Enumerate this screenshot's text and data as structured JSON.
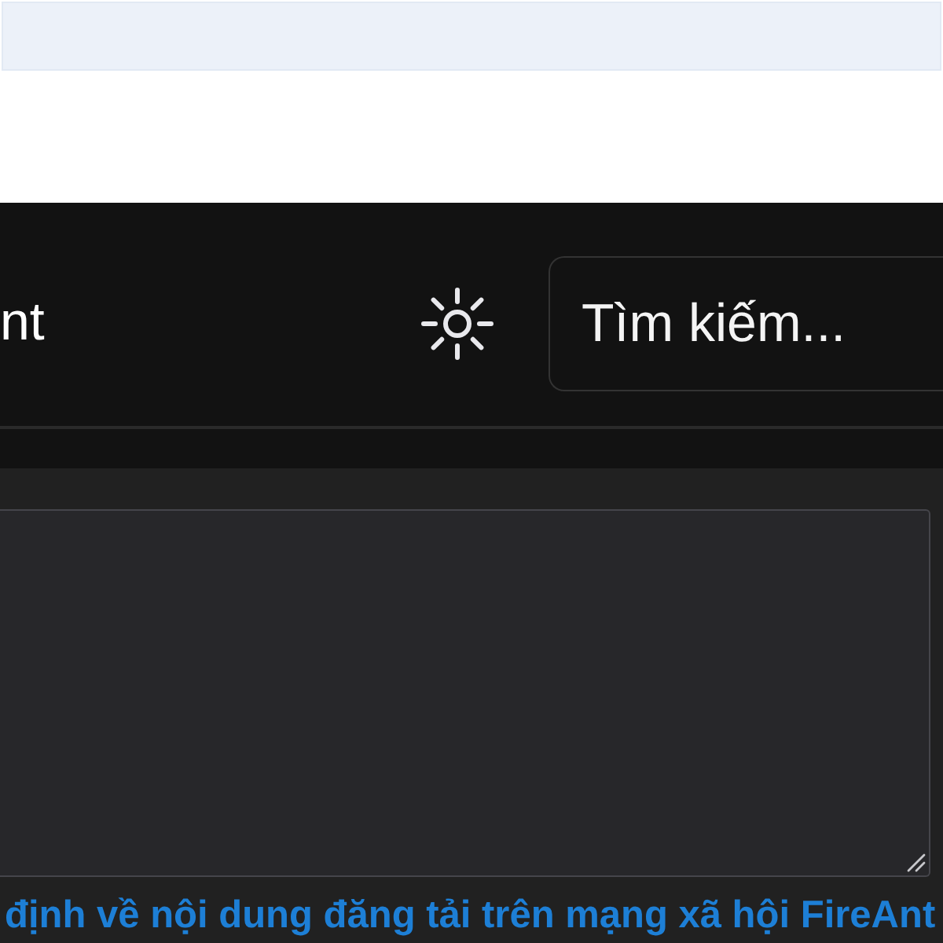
{
  "header": {
    "logo_text": "nt",
    "search": {
      "placeholder": "Tìm kiếm..."
    }
  },
  "notice_link": {
    "text": "định về nội dung đăng tải trên mạng xã hội FireAnt"
  }
}
